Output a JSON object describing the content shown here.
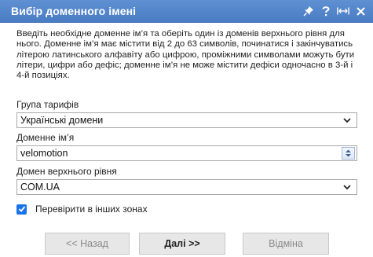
{
  "dialog": {
    "title": "Вибір доменного імені",
    "description": "Введіть необхідне доменне ім’я та оберіть один із доменів верхнього рівня для нього. Доменне ім’я має містити від 2 до 63 символів, починатися і закінчуватись літерою латинського алфавіту або цифрою, проміжними символами можуть бути літери, цифри або дефіс; доменне ім’я не може містити дефіси одночасно в 3-й і 4-й позиціях.",
    "icons": [
      "pin-icon",
      "help-icon",
      "expand-icon",
      "close-icon"
    ]
  },
  "form": {
    "tariff_group": {
      "label": "Група тарифів",
      "value": "Українські домени"
    },
    "domain_name": {
      "label": "Доменне ім’я",
      "value": "velomotion"
    },
    "tld": {
      "label": "Домен верхнього рівня",
      "value": "COM.UA"
    },
    "check_other_zones": {
      "label": "Перевірити в інших зонах",
      "checked": true
    }
  },
  "buttons": {
    "back": "<< Назад",
    "next": "Далі >>",
    "cancel": "Відміна"
  },
  "colors": {
    "titlebar": "#5286cd",
    "checkbox": "#1a73e8",
    "button_bg": "#e7e7e7"
  }
}
